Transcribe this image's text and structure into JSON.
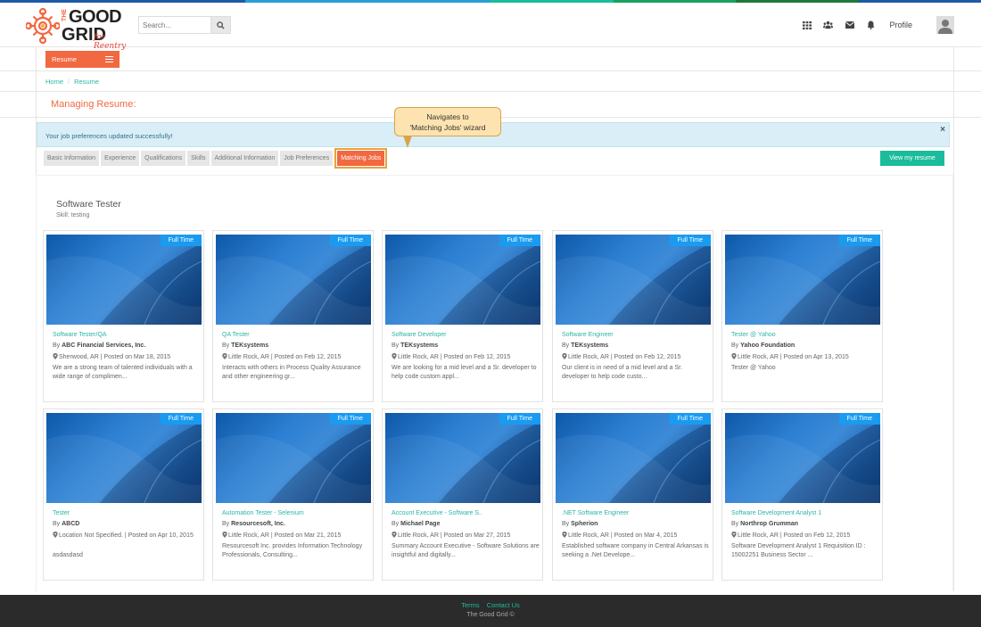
{
  "colors": {
    "accent": "#f26841",
    "teal": "#1bbc9b",
    "link": "#2ab5a3",
    "badge": "#1a9bf0",
    "stripe": [
      "#1e5aa8",
      "#1e5aa8",
      "#2a9fd6",
      "#2a9fd6",
      "#1bbc9b",
      "#1aa15c",
      "#1e7a3c",
      "#1e5aa8"
    ]
  },
  "header": {
    "logo_the": "THE",
    "logo_good": "GOOD",
    "logo_grid": "GRID",
    "logo_tagline": "for Reentry",
    "search_placeholder": "Search...",
    "profile_label": "Profile",
    "icons": [
      "apps-grid-icon",
      "users-icon",
      "mail-icon",
      "bell-icon",
      "search-icon"
    ]
  },
  "nav": {
    "resume_label": "Resume"
  },
  "breadcrumb": {
    "home": "Home",
    "current": "Resume"
  },
  "page_title": "Managing Resume:",
  "alert": {
    "message": "Your job preferences updated successfully!",
    "close": "×"
  },
  "callout": {
    "line1": "Navigates to",
    "line2": "'Matching Jobs' wizard"
  },
  "wizard": {
    "steps": [
      "Basic Information",
      "Experience",
      "Qualifications",
      "Skills",
      "Additional Information",
      "Job Preferences"
    ],
    "active": "Matching Jobs"
  },
  "view_resume_label": "View my resume",
  "preference": {
    "title": "Software Tester",
    "skill": "Skill: testing"
  },
  "jobs": [
    {
      "badge": "Full Time",
      "title": "Software Tester/QA",
      "by": "By",
      "company": "ABC Financial Services, Inc.",
      "location": "Sherwood, AR | Posted on Mar 18, 2015",
      "desc": "We are a strong team of talented individuals with a wide range of complimen..."
    },
    {
      "badge": "Full Time",
      "title": "QA Tester",
      "by": "By",
      "company": "TEKsystems",
      "location": "Little Rock, AR | Posted on Feb 12, 2015",
      "desc": "Interacts with others in Process Quality Assurance and other engineering gr..."
    },
    {
      "badge": "Full Time",
      "title": "Software Developer",
      "by": "By",
      "company": "TEKsystems",
      "location": "Little Rock, AR | Posted on Feb 12, 2015",
      "desc": "We are looking for a mid level and a Sr. developer to help code custom appl..."
    },
    {
      "badge": "Full Time",
      "title": "Software Engineer",
      "by": "By",
      "company": "TEKsystems",
      "location": "Little Rock, AR | Posted on Feb 12, 2015",
      "desc": "Our client is in need of a mid level and a Sr. developer to help code custo..."
    },
    {
      "badge": "Full Time",
      "title": "Tester @ Yahoo",
      "by": "By",
      "company": "Yahoo Foundation",
      "location": "Little Rock, AR | Posted on Apr 13, 2015",
      "desc": "Tester @ Yahoo"
    },
    {
      "badge": "Full Time",
      "title": "Tester",
      "by": "By",
      "company": "ABCD",
      "location": "Location Not Specified. | Posted on Apr 10, 2015",
      "desc": "asdasdasd"
    },
    {
      "badge": "Full Time",
      "title": "Automation Tester - Selenium",
      "by": "By",
      "company": "Resourcesoft, Inc.",
      "location": "Little Rock, AR | Posted on Mar 21, 2015",
      "desc": "Resourcesoft Inc. provides Information Technology Professionals, Consulting..."
    },
    {
      "badge": "Full Time",
      "title": "Account Executive - Software S..",
      "by": "By",
      "company": "Michael Page",
      "location": "Little Rock, AR | Posted on Mar 27, 2015",
      "desc": "Summary Account Executive - Software Solutions are insightful and digitally..."
    },
    {
      "badge": "Full Time",
      "title": ".NET Software Engineer",
      "by": "By",
      "company": "Spherion",
      "location": "Little Rock, AR | Posted on Mar 4, 2015",
      "desc": "Established software company in Central Arkansas is seeking a .Net Develope..."
    },
    {
      "badge": "Full Time",
      "title": "Software Development Analyst 1",
      "by": "By",
      "company": "Northrop Grumman",
      "location": "Little Rock, AR | Posted on Feb 12, 2015",
      "desc": "Software Development Analyst 1 Requisition ID : 15002251 Business Sector ..."
    }
  ],
  "footer": {
    "terms": "Terms",
    "contact": "Contact Us",
    "copyright": "The Good Grid ©"
  }
}
